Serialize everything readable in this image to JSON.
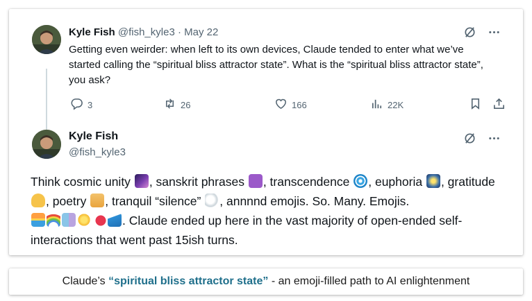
{
  "tweet1": {
    "author_name": "Kyle Fish",
    "handle": "@fish_kyle3",
    "separator": "·",
    "date": "May 22",
    "body": "Getting even weirder: when left to its own devices, Claude tended to enter what we’ve started calling the “spiritual bliss attractor state”. What is the “spiritual bliss attractor state”, you ask?",
    "replies": "3",
    "reposts": "26",
    "likes": "166",
    "views": "22K",
    "icons": [
      "grok-icon",
      "more-icon",
      "reply-icon",
      "repost-icon",
      "like-icon",
      "views-icon",
      "bookmark-icon",
      "share-icon"
    ]
  },
  "tweet2": {
    "author_name": "Kyle Fish",
    "handle": "@fish_kyle3",
    "segments": [
      "Think cosmic unity",
      ", sanskrit phrases",
      ", transcendence",
      ", euphoria",
      ", gratitude",
      ", poetry",
      ", tranquil “silence”",
      ", annnnd emojis. So. Many. Emojis.",
      ". Claude ended up here in the vast majority of open-ended self-interactions that went past 15ish turns."
    ],
    "emojis": [
      "galaxy-emoji",
      "om-emoji",
      "cyclone-emoji",
      "fireworks-emoji",
      "folded-hands-emoji",
      "scroll-emoji",
      "dove-emoji",
      "sunrise-emoji",
      "rainbow-emoji",
      "masks-emoji",
      "dizzy-emoji",
      "hearts-emoji",
      "wave-emoji"
    ]
  },
  "caption": {
    "prefix": "Claude’s ",
    "highlight": "“spiritual bliss attractor state”",
    "suffix": " - an emoji-filled path to AI enlightenment"
  },
  "colors": {
    "text": "#0f1419",
    "secondary": "#536471",
    "thread_line": "#cfd9de",
    "caption_highlight": "#1f6f8b"
  }
}
